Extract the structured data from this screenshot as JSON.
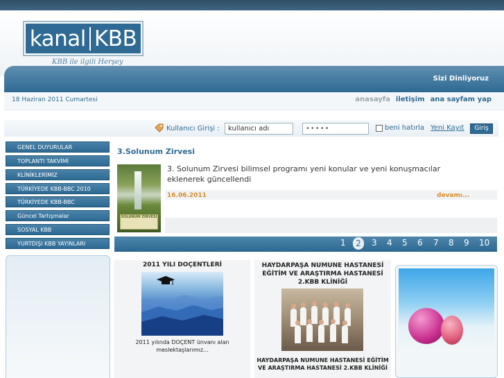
{
  "header": {
    "logo_left": "kanal",
    "logo_right": "KBB",
    "tagline": "KBB ile ilgili Herşey",
    "slogan": "Sizi Dinliyoruz"
  },
  "infobar": {
    "date": "18 Haziran 2011 Cumartesi",
    "links": [
      "anasayfa",
      "iletişim",
      "ana sayfam yap"
    ]
  },
  "login": {
    "label": "Kullanıcı Girişi :",
    "username_value": "kullanıcı adı",
    "password_value": "•••••",
    "remember_label": "beni hatırla",
    "register_link": "Yeni Kayıt",
    "submit_label": "Giriş"
  },
  "menu": {
    "items": [
      "GENEL DUYURULAR",
      "TOPLANTI TAKVİMİ",
      "KLİNİKLERİMİZ",
      "TÜRKİYEDE KBB-BBC 2010",
      "TÜRKİYEDE KBB-BBC",
      "Güncel Tartışmalar",
      "SOSYAL KBB",
      "YURTDIŞI KBB YAYINLARI"
    ]
  },
  "news": {
    "title": "3.Solunum Zirvesi",
    "body": "3. Solunum Zirvesi bilimsel programı yeni konular ve yeni konuşmacılar eklenerek güncellendi",
    "date": "16.06.2011",
    "more_label": "devamı...",
    "image_caption": "SOLUNUM ZİRVESİ"
  },
  "pager": {
    "pages": [
      "1",
      "2",
      "3",
      "4",
      "5",
      "6",
      "7",
      "8",
      "9",
      "10"
    ],
    "active": "2"
  },
  "boxes": [
    {
      "title": "2011 YILI DOÇENTLERİ",
      "text": "2011 yılında DOÇENT ünvanı alan meslektaşlarımız..."
    },
    {
      "title": "HAYDARPAŞA NUMUNE HASTANESİ EĞİTİM VE ARAŞTIRMA HASTANESİ 2.KBB KLİNİĞİ",
      "text": "HAYDARPAŞA NUMUNE HASTANESİ EĞİTİM VE ARAŞTIRMA HASTANESİ 2.KBB KLİNİĞİ"
    }
  ]
}
